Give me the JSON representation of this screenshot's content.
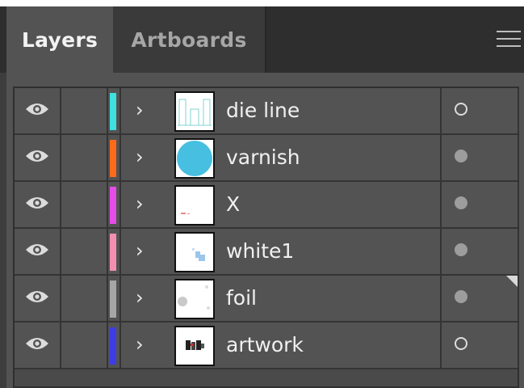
{
  "tabs": [
    {
      "label": "Layers",
      "active": true
    },
    {
      "label": "Artboards",
      "active": false
    }
  ],
  "menu_icon": "hamburger-menu-icon",
  "layers": [
    {
      "name": "die line",
      "color": "#3fe0e0",
      "thumb": "dieline",
      "target": "hollow",
      "visible": true
    },
    {
      "name": "varnish",
      "color": "#ff6a1a",
      "thumb": "circle",
      "target": "filled",
      "visible": true
    },
    {
      "name": "X",
      "color": "#e64ce6",
      "thumb": "x",
      "target": "filled",
      "visible": true
    },
    {
      "name": "white1",
      "color": "#f28fb0",
      "thumb": "white1",
      "target": "filled",
      "visible": true
    },
    {
      "name": "foil",
      "color": "#a6a6a6",
      "thumb": "foil",
      "target": "filled",
      "visible": true
    },
    {
      "name": "artwork",
      "color": "#3d3de6",
      "thumb": "artwork",
      "target": "hollow",
      "visible": true
    }
  ]
}
